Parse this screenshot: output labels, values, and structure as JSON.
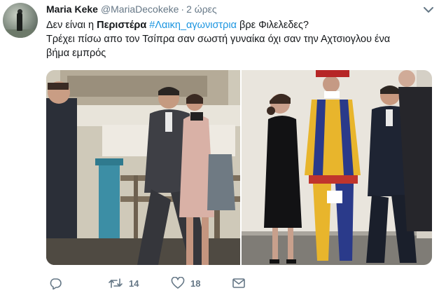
{
  "user": {
    "display_name": "Maria Keke",
    "handle": "@MariaDecokeke",
    "separator": "·",
    "time": "2 ώρες"
  },
  "tweet": {
    "line1_pre": "Δεν είναι η ",
    "line1_bold": "Περιστέρα",
    "line1_space": " ",
    "line1_hashtag": "#Λαικη_αγωνιστρια",
    "line1_post": " βρε Φιλελεδες?",
    "line2": "Τρέχει πίσω απο τον Τσίπρα σαν σωστή γυναίκα όχι σαν την Αχτσιογλου ένα",
    "line3": "βήμα εμπρός"
  },
  "actions": {
    "reply_icon": "reply-icon",
    "retweet_icon": "retweet-icon",
    "retweet_count": "14",
    "like_icon": "heart-icon",
    "like_count": "18",
    "message_icon": "envelope-icon"
  },
  "colors": {
    "text": "#14171a",
    "muted": "#657786",
    "link": "#1b95e0"
  }
}
